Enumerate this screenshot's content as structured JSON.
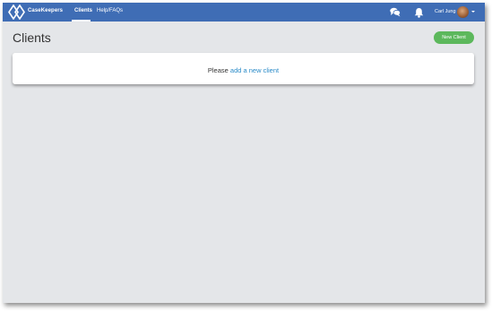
{
  "navbar": {
    "brand": "CaseKeepers",
    "links": [
      {
        "label": "Clients",
        "active": true
      },
      {
        "label": "Help/FAQs",
        "active": false
      }
    ],
    "icons": [
      "chat-icon",
      "bell-icon"
    ],
    "user_name": "Carl Jung"
  },
  "page": {
    "title": "Clients",
    "new_button_label": "New Client"
  },
  "empty_state": {
    "prefix": "Please",
    "link_text": "add a new client"
  },
  "colors": {
    "navbar": "#3f6db5",
    "background": "#e4e6e9",
    "button": "#5cb85c",
    "link": "#2a8bc8"
  }
}
